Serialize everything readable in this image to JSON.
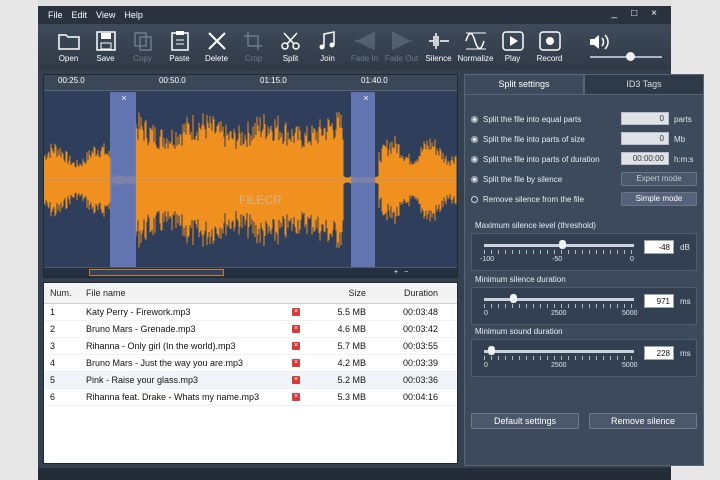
{
  "menu": [
    "File",
    "Edit",
    "View",
    "Help"
  ],
  "window_controls": [
    "_",
    "□",
    "×"
  ],
  "toolbar": [
    {
      "label": "Open",
      "icon": "folder-icon",
      "enabled": true
    },
    {
      "label": "Save",
      "icon": "disk-icon",
      "enabled": true
    },
    {
      "label": "Copy",
      "icon": "copy-icon",
      "enabled": false
    },
    {
      "label": "Paste",
      "icon": "clipboard-icon",
      "enabled": true
    },
    {
      "label": "Delete",
      "icon": "x-cross-icon",
      "enabled": true
    },
    {
      "label": "Crop",
      "icon": "crop-icon",
      "enabled": false
    },
    {
      "label": "Split",
      "icon": "scissors-icon",
      "enabled": true
    },
    {
      "label": "Join",
      "icon": "notes-icon",
      "enabled": true
    },
    {
      "label": "Fade In",
      "icon": "fade-in-icon",
      "enabled": false
    },
    {
      "label": "Fade Out",
      "icon": "fade-out-icon",
      "enabled": false
    },
    {
      "label": "Silence",
      "icon": "silence-icon",
      "enabled": true
    },
    {
      "label": "Normalize",
      "icon": "normalize-icon",
      "enabled": true
    },
    {
      "label": "Play",
      "icon": "play-icon",
      "enabled": true
    },
    {
      "label": "Record",
      "icon": "record-icon",
      "enabled": true
    }
  ],
  "volume": {
    "icon": "speaker-icon",
    "level": 0.55
  },
  "waveform": {
    "ruler": [
      "00:25.0",
      "00:50.0",
      "01:15.0",
      "01:40.0"
    ],
    "colors": {
      "wave": "#f0901e",
      "background": "#2e3e5b",
      "silence": "#6c7fc0"
    },
    "watermark": "FILECR"
  },
  "file_list": {
    "headers": {
      "num": "Num.",
      "name": "File name",
      "size": "Size",
      "duration": "Duration"
    },
    "rows": [
      {
        "num": "1",
        "name": "Katy Perry - Firework.mp3",
        "size": "5.5 MB",
        "duration": "00:03:48"
      },
      {
        "num": "2",
        "name": "Bruno Mars - Grenade.mp3",
        "size": "4.6 MB",
        "duration": "00:03:42"
      },
      {
        "num": "3",
        "name": "Rihanna - Only girl (In the world).mp3",
        "size": "5.7 MB",
        "duration": "00:03:55"
      },
      {
        "num": "4",
        "name": "Bruno Mars - Just the way you are.mp3",
        "size": "4.2 MB",
        "duration": "00:03:39"
      },
      {
        "num": "5",
        "name": "Pink - Raise your glass.mp3",
        "size": "5.2 MB",
        "duration": "00:03:36"
      },
      {
        "num": "6",
        "name": "Rihanna feat. Drake - Whats my name.mp3",
        "size": "5.3 MB",
        "duration": "00:04:16"
      }
    ]
  },
  "panel": {
    "tabs": [
      "Split settings",
      "ID3 Tags"
    ],
    "options": [
      {
        "label": "Split the file into equal parts",
        "value": "0",
        "unit": "parts"
      },
      {
        "label": "Split the file into parts of size",
        "value": "0",
        "unit": "Mb"
      },
      {
        "label": "Split the file into parts of duration",
        "value": "00:00:00",
        "unit": "h:m:s"
      },
      {
        "label": "Split the file by silence",
        "button": "Expert mode"
      },
      {
        "label": "Remove silence from the file",
        "button": "Simple mode"
      }
    ],
    "threshold": {
      "label": "Maximum silence level (threshold)",
      "min": "-100",
      "mid": "-50",
      "max": "0",
      "value": "-48",
      "unit": "dB",
      "fraction": 0.52
    },
    "min_silence": {
      "label": "Minimum silence duration",
      "min": "0",
      "mid": "2500",
      "max": "5000",
      "value": "971",
      "unit": "ms",
      "fraction": 0.194
    },
    "min_sound": {
      "label": "Minimum sound duration",
      "min": "0",
      "mid": "2500",
      "max": "5000",
      "value": "228",
      "unit": "ms",
      "fraction": 0.046
    },
    "buttons": {
      "default": "Default settings",
      "remove": "Remove silence"
    }
  }
}
